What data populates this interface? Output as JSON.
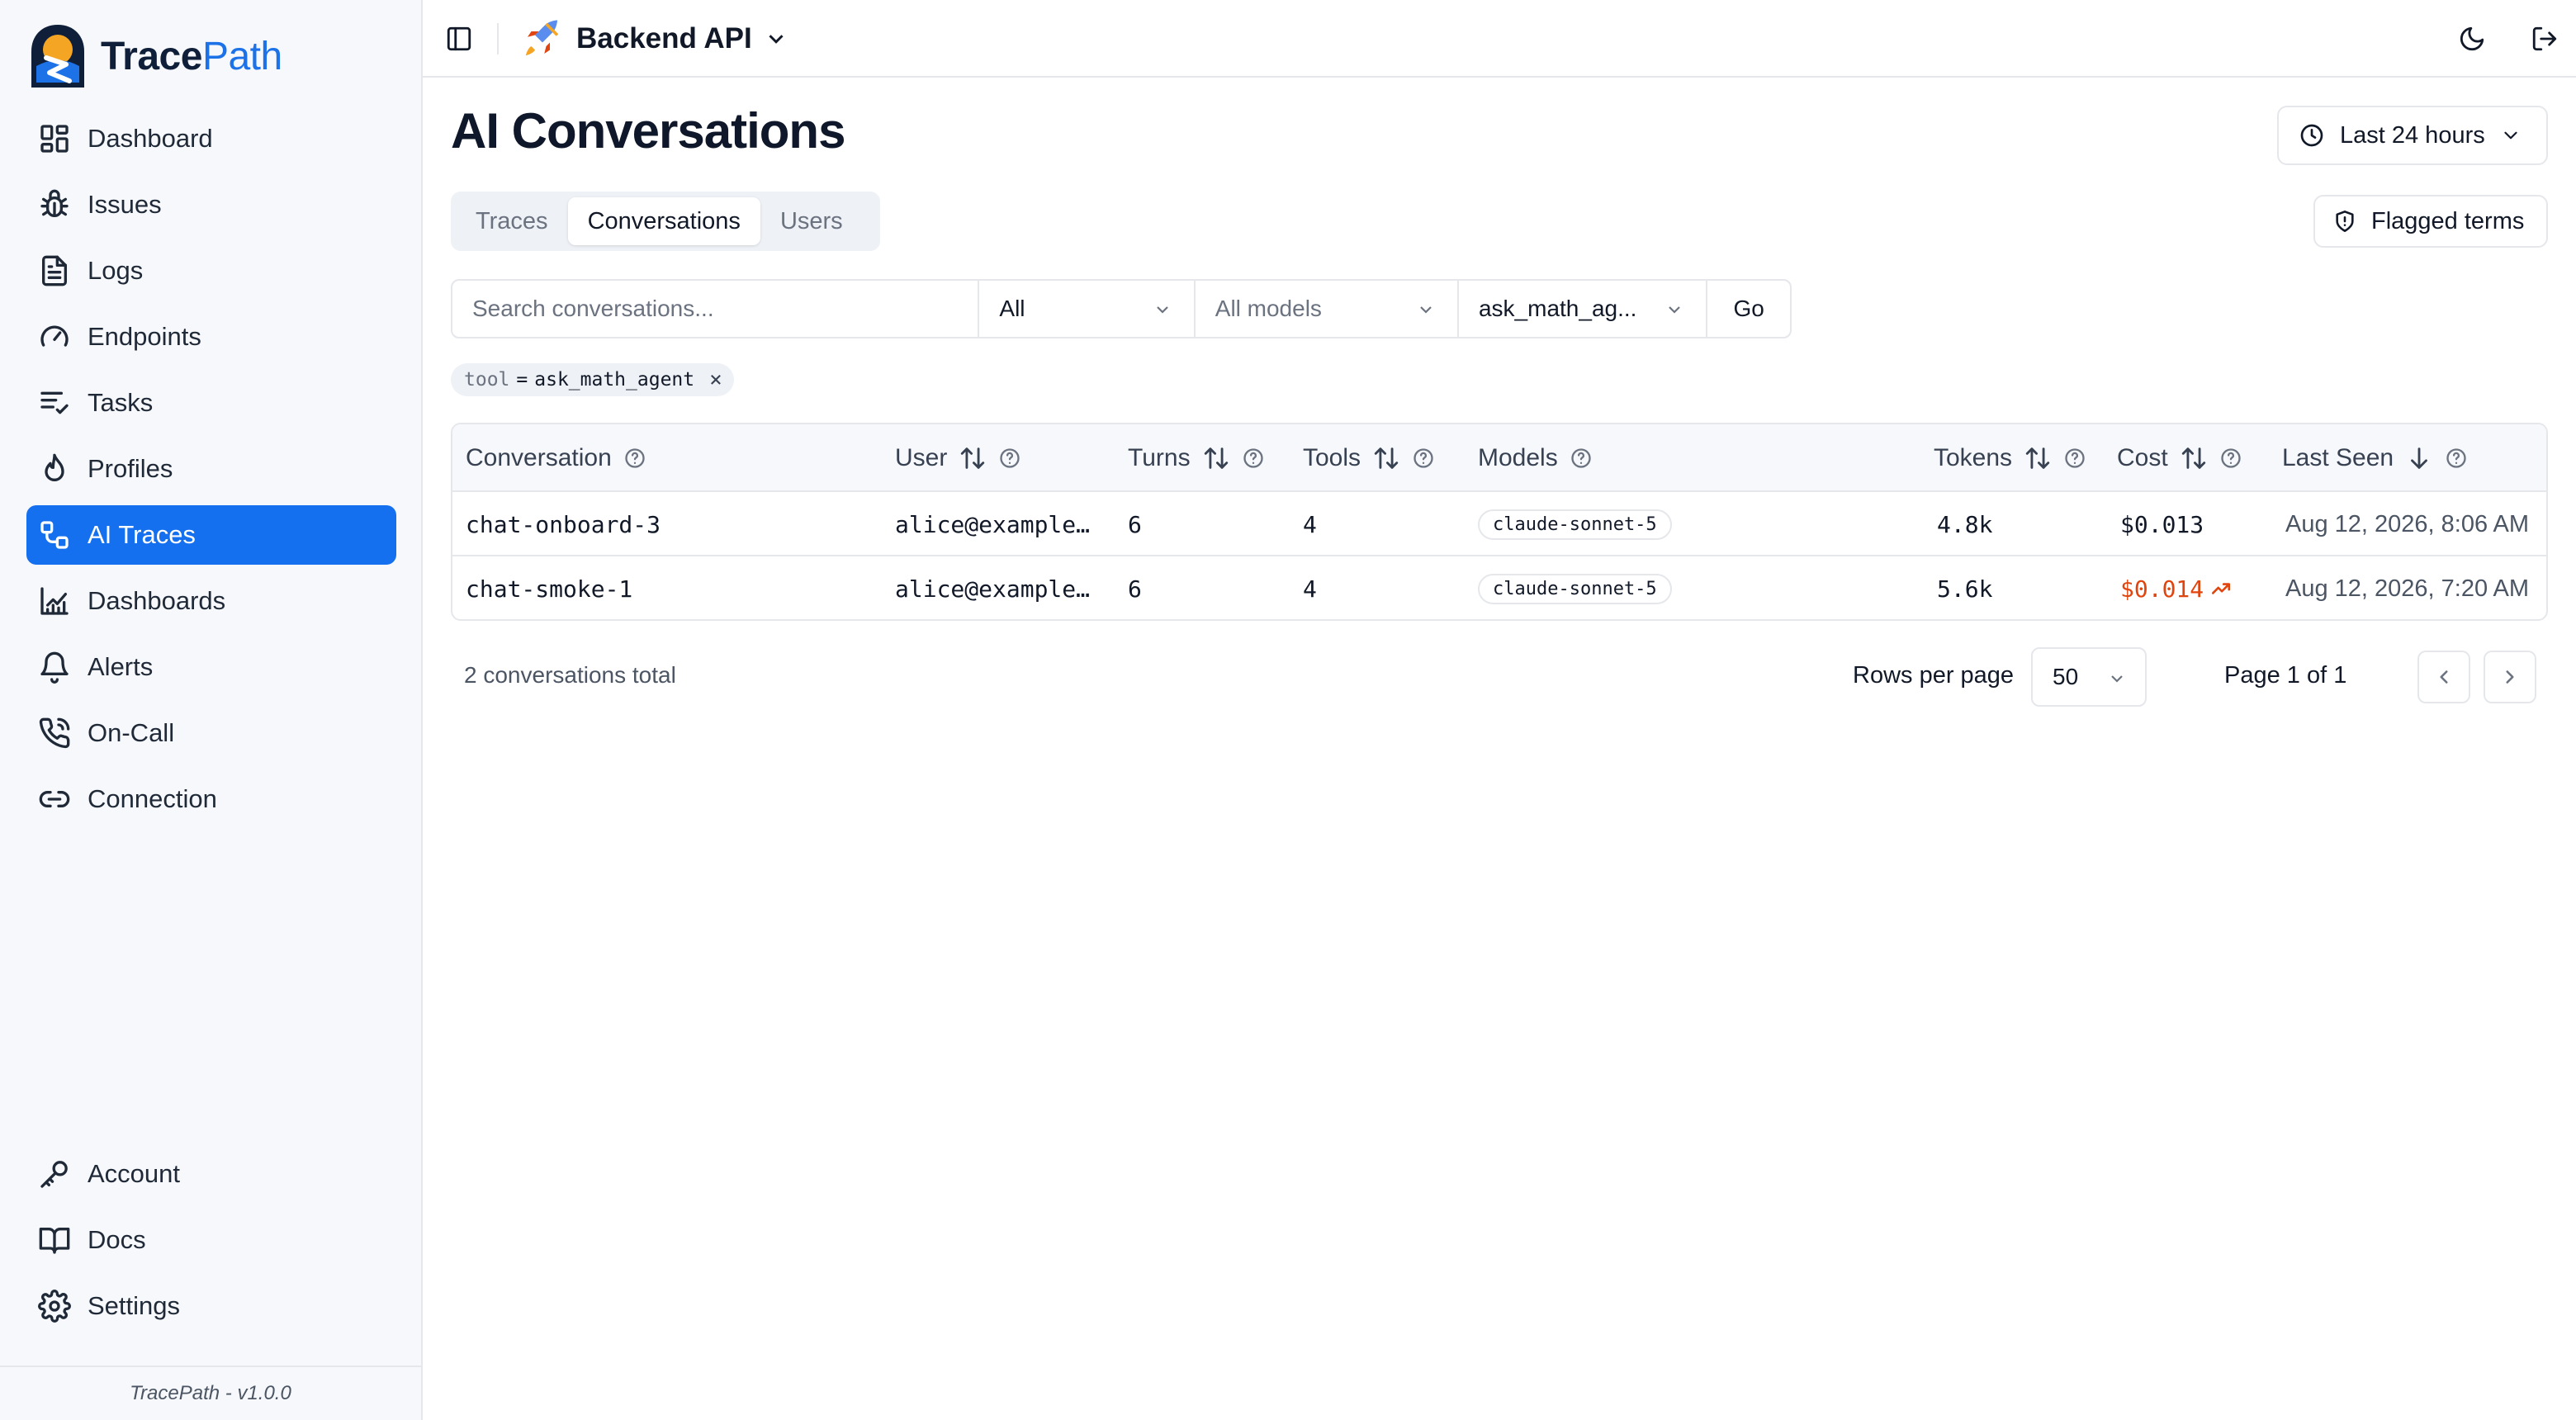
{
  "brand": {
    "name_part1": "Trace",
    "name_part2": "Path",
    "version": "TracePath - v1.0.0"
  },
  "sidebar": {
    "items": [
      {
        "label": "Dashboard",
        "icon": "dashboard-grid-icon"
      },
      {
        "label": "Issues",
        "icon": "bug-icon"
      },
      {
        "label": "Logs",
        "icon": "file-text-icon"
      },
      {
        "label": "Endpoints",
        "icon": "gauge-icon"
      },
      {
        "label": "Tasks",
        "icon": "list-checks-icon"
      },
      {
        "label": "Profiles",
        "icon": "flame-icon"
      },
      {
        "label": "AI Traces",
        "icon": "workflow-icon",
        "active": true
      },
      {
        "label": "Dashboards",
        "icon": "chart-icon"
      },
      {
        "label": "Alerts",
        "icon": "bell-icon"
      },
      {
        "label": "On-Call",
        "icon": "phone-icon"
      },
      {
        "label": "Connection",
        "icon": "link-icon"
      }
    ],
    "bottom_items": [
      {
        "label": "Account",
        "icon": "key-icon"
      },
      {
        "label": "Docs",
        "icon": "book-icon"
      },
      {
        "label": "Settings",
        "icon": "gear-icon"
      }
    ]
  },
  "topbar": {
    "project_name": "Backend API"
  },
  "page": {
    "title": "AI Conversations",
    "time_range": "Last 24 hours",
    "flagged_terms_label": "Flagged terms",
    "tabs": [
      "Traces",
      "Conversations",
      "Users"
    ],
    "active_tab": "Conversations"
  },
  "filters": {
    "search_placeholder": "Search conversations...",
    "scope": "All",
    "models": "All models",
    "tool": "ask_math_ag...",
    "go_label": "Go"
  },
  "active_filter_chip": {
    "key": "tool",
    "op": "=",
    "value": "ask_math_agent"
  },
  "table": {
    "columns": [
      "Conversation",
      "User",
      "Turns",
      "Tools",
      "Models",
      "Tokens",
      "Cost",
      "Last Seen"
    ],
    "rows": [
      {
        "conversation": "chat-onboard-3",
        "user": "alice@example…",
        "turns": "6",
        "tools": "4",
        "model": "claude-sonnet-5",
        "tokens": "4.8k",
        "cost": "$0.013",
        "last_seen": "Aug 12, 2026, 8:06 AM",
        "cost_trend": false
      },
      {
        "conversation": "chat-smoke-1",
        "user": "alice@example…",
        "turns": "6",
        "tools": "4",
        "model": "claude-sonnet-5",
        "tokens": "5.6k",
        "cost": "$0.014",
        "last_seen": "Aug 12, 2026, 7:20 AM",
        "cost_trend": true
      }
    ]
  },
  "pagination": {
    "total_label": "2 conversations total",
    "rows_per_page_label": "Rows per page",
    "rows_per_page": "50",
    "page_label": "Page 1 of 1"
  },
  "colors": {
    "accent": "#1570ef",
    "cost_alert": "#e0450f"
  }
}
